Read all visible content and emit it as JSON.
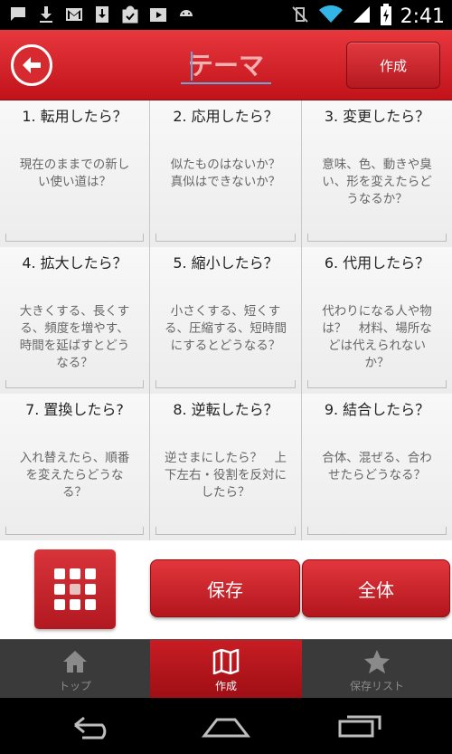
{
  "status_bar": {
    "left_icons": [
      "chat-icon",
      "download-icon",
      "gmail-icon",
      "download-box-icon",
      "bag-check-icon",
      "play-store-icon",
      "android-icon"
    ],
    "time": "2:41"
  },
  "header": {
    "theme_placeholder": "テーマ",
    "create_label": "作成"
  },
  "cells": [
    {
      "title": "1. 転用したら？",
      "body": "現在のままでの新しい使い道は？"
    },
    {
      "title": "2. 応用したら？",
      "body": "似たものはないか？　真似はできないか？"
    },
    {
      "title": "3. 変更したら？",
      "body": "意味、色、動きや臭い、形を変えたらどうなるか？"
    },
    {
      "title": "4. 拡大したら？",
      "body": "大きくする、長くする、頻度を増やす、時間を延ばすとどうなる？"
    },
    {
      "title": "5. 縮小したら？",
      "body": "小さくする、短くする、圧縮する、短時間にするとどうなる？"
    },
    {
      "title": "6. 代用したら？",
      "body": "代わりになる人や物は？　材料、場所などは代えられないか？"
    },
    {
      "title": "7. 置換したら?",
      "body": "入れ替えたら、順番を変えたらどうなる？"
    },
    {
      "title": "8. 逆転したら？",
      "body": "逆さまにしたら？　上下左右・役割を反対にしたら？"
    },
    {
      "title": "9. 結合したら？",
      "body": "合体、混ぜる、合わせたらどうなる？"
    }
  ],
  "actions": {
    "save_label": "保存",
    "all_label": "全体"
  },
  "tabs": [
    {
      "label": "トップ",
      "icon": "home-icon",
      "active": false
    },
    {
      "label": "作成",
      "icon": "map-icon",
      "active": true
    },
    {
      "label": "保存リスト",
      "icon": "star-icon",
      "active": false
    }
  ],
  "colors": {
    "brand_red": "#c1121a",
    "tab_bar": "#3a3a3a"
  }
}
